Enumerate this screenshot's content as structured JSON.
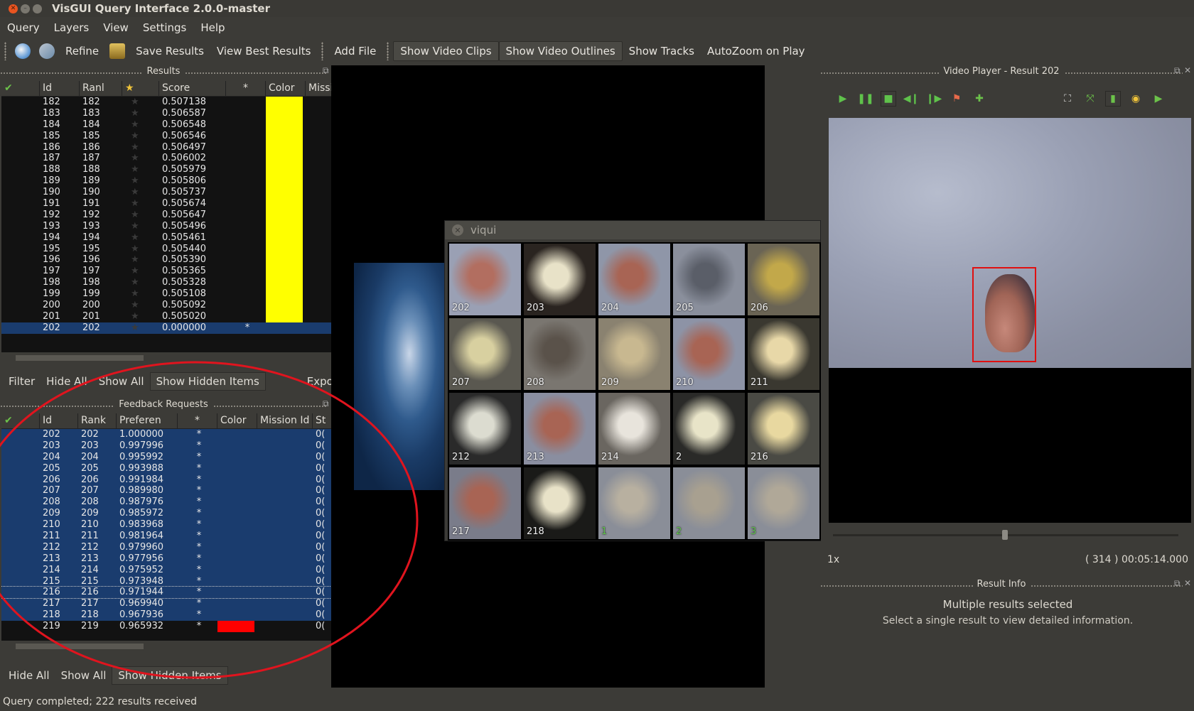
{
  "window": {
    "title": "VisGUI Query Interface 2.0.0-master"
  },
  "menu": [
    "Query",
    "Layers",
    "View",
    "Settings",
    "Help"
  ],
  "toolbar": {
    "refine": "Refine",
    "save_results": "Save Results",
    "view_best": "View Best Results",
    "add_file": "Add File",
    "show_video_clips": "Show Video Clips",
    "show_video_outlines": "Show Video Outlines",
    "show_tracks": "Show Tracks",
    "autozoom": "AutoZoom on Play"
  },
  "results": {
    "title": "Results",
    "columns": [
      "Id",
      "Ranl",
      "★",
      "Score",
      "*",
      "Color",
      "Mission"
    ],
    "rows": [
      [
        "182",
        "182",
        "0.507138",
        ""
      ],
      [
        "183",
        "183",
        "0.506587",
        ""
      ],
      [
        "184",
        "184",
        "0.506548",
        ""
      ],
      [
        "185",
        "185",
        "0.506546",
        ""
      ],
      [
        "186",
        "186",
        "0.506497",
        ""
      ],
      [
        "187",
        "187",
        "0.506002",
        ""
      ],
      [
        "188",
        "188",
        "0.505979",
        ""
      ],
      [
        "189",
        "189",
        "0.505806",
        ""
      ],
      [
        "190",
        "190",
        "0.505737",
        ""
      ],
      [
        "191",
        "191",
        "0.505674",
        ""
      ],
      [
        "192",
        "192",
        "0.505647",
        ""
      ],
      [
        "193",
        "193",
        "0.505496",
        ""
      ],
      [
        "194",
        "194",
        "0.505461",
        ""
      ],
      [
        "195",
        "195",
        "0.505440",
        ""
      ],
      [
        "196",
        "196",
        "0.505390",
        ""
      ],
      [
        "197",
        "197",
        "0.505365",
        ""
      ],
      [
        "198",
        "198",
        "0.505328",
        ""
      ],
      [
        "199",
        "199",
        "0.505108",
        ""
      ],
      [
        "200",
        "200",
        "0.505092",
        ""
      ],
      [
        "201",
        "201",
        "0.505020",
        ""
      ],
      [
        "202",
        "202",
        "0.000000",
        "*"
      ]
    ],
    "color_fill": "#ffff00",
    "filterbar": {
      "filter": "Filter",
      "hide_all": "Hide All",
      "show_all": "Show All",
      "show_hidden": "Show Hidden Items",
      "export": "Export"
    }
  },
  "feedback": {
    "title": "Feedback Requests",
    "columns": [
      "Id",
      "Rank",
      "Preferen",
      "*",
      "Color",
      "Mission Id",
      "St"
    ],
    "rows": [
      [
        "202",
        "202",
        "1.000000",
        "*"
      ],
      [
        "203",
        "203",
        "0.997996",
        "*"
      ],
      [
        "204",
        "204",
        "0.995992",
        "*"
      ],
      [
        "205",
        "205",
        "0.993988",
        "*"
      ],
      [
        "206",
        "206",
        "0.991984",
        "*"
      ],
      [
        "207",
        "207",
        "0.989980",
        "*"
      ],
      [
        "208",
        "208",
        "0.987976",
        "*"
      ],
      [
        "209",
        "209",
        "0.985972",
        "*"
      ],
      [
        "210",
        "210",
        "0.983968",
        "*"
      ],
      [
        "211",
        "211",
        "0.981964",
        "*"
      ],
      [
        "212",
        "212",
        "0.979960",
        "*"
      ],
      [
        "213",
        "213",
        "0.977956",
        "*"
      ],
      [
        "214",
        "214",
        "0.975952",
        "*"
      ],
      [
        "215",
        "215",
        "0.973948",
        "*"
      ],
      [
        "216",
        "216",
        "0.971944",
        "*"
      ],
      [
        "217",
        "217",
        "0.969940",
        "*"
      ],
      [
        "218",
        "218",
        "0.967936",
        "*"
      ],
      [
        "219",
        "219",
        "0.965932",
        "*"
      ]
    ],
    "st_value": "0(",
    "highlight_color": "#ff0000",
    "filterbar": {
      "hide_all": "Hide All",
      "show_all": "Show All",
      "show_hidden": "Show Hidden Items"
    }
  },
  "viqui": {
    "title": "viqui",
    "tiles": [
      "202",
      "203",
      "204",
      "205",
      "206",
      "207",
      "208",
      "209",
      "210",
      "211",
      "212",
      "213",
      "214",
      "2",
      "216",
      "217",
      "218",
      "1",
      "2",
      "3"
    ]
  },
  "video_player": {
    "title": "Video Player - Result 202",
    "speed": "1x",
    "time": "( 314 ) 00:05:14.000"
  },
  "result_info": {
    "title": "Result Info",
    "heading": "Multiple results selected",
    "message": "Select a single result to view detailed information."
  },
  "status": "Query completed; 222 results received",
  "colors": {
    "selection": "#1a3c6e",
    "annotation_circle": "#e0141e",
    "bbox": "#e01010"
  }
}
